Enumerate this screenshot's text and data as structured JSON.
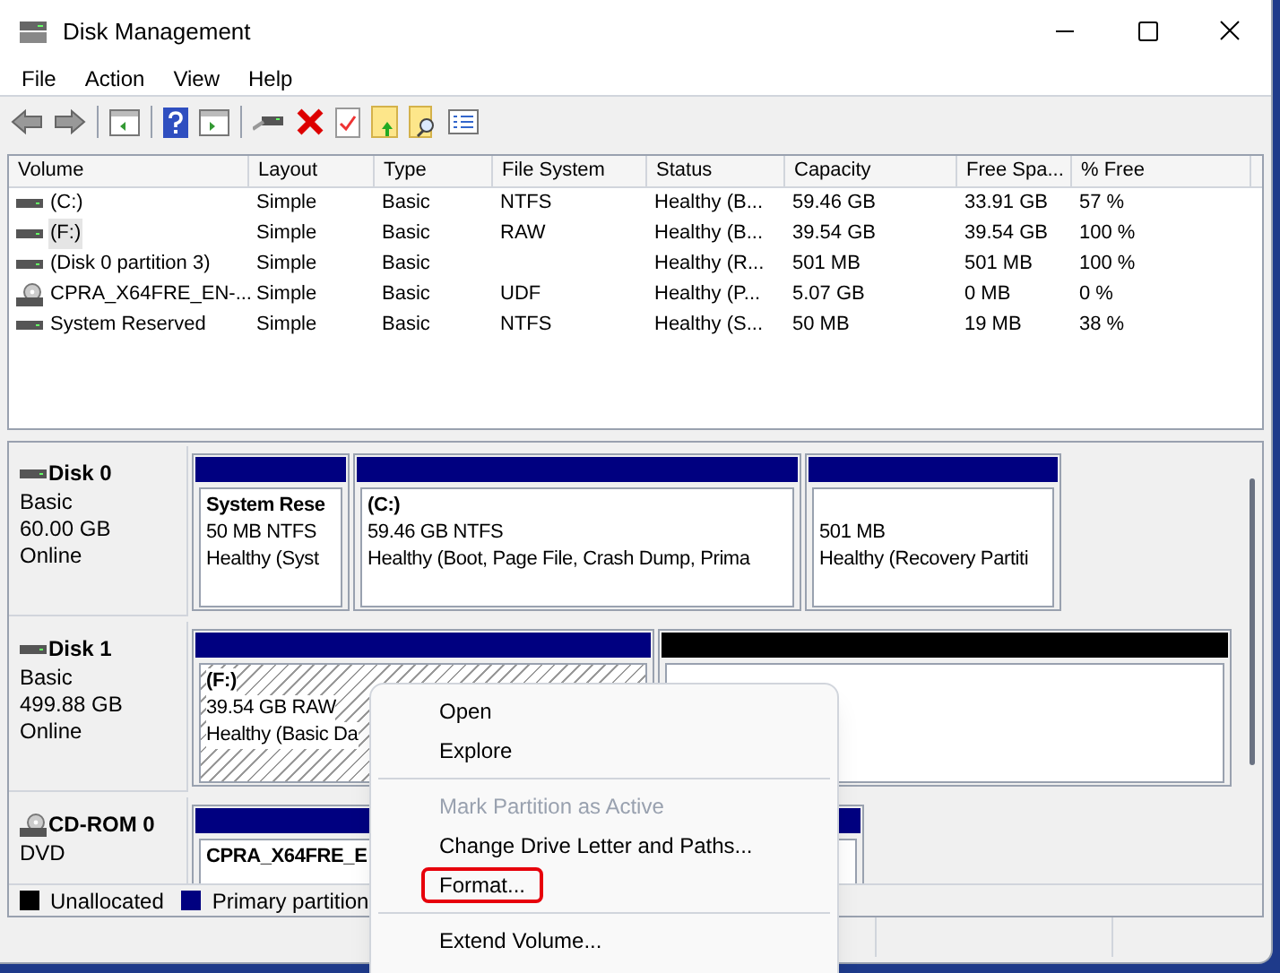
{
  "window": {
    "title": "Disk Management"
  },
  "menu": [
    "File",
    "Action",
    "View",
    "Help"
  ],
  "table": {
    "columns": [
      "Volume",
      "Layout",
      "Type",
      "File System",
      "Status",
      "Capacity",
      "Free Spa...",
      "% Free"
    ],
    "rows": [
      {
        "kind": "disk",
        "selected": false,
        "cells": [
          "(C:)",
          "Simple",
          "Basic",
          "NTFS",
          "Healthy (B...",
          "59.46 GB",
          "33.91 GB",
          "57 %"
        ]
      },
      {
        "kind": "disk",
        "selected": true,
        "cells": [
          "(F:)",
          "Simple",
          "Basic",
          "RAW",
          "Healthy (B...",
          "39.54 GB",
          "39.54 GB",
          "100 %"
        ]
      },
      {
        "kind": "disk",
        "selected": false,
        "cells": [
          "(Disk 0 partition 3)",
          "Simple",
          "Basic",
          "",
          "Healthy (R...",
          "501 MB",
          "501 MB",
          "100 %"
        ]
      },
      {
        "kind": "cd",
        "selected": false,
        "cells": [
          "CPRA_X64FRE_EN-...",
          "Simple",
          "Basic",
          "UDF",
          "Healthy (P...",
          "5.07 GB",
          "0 MB",
          "0 %"
        ]
      },
      {
        "kind": "disk",
        "selected": false,
        "cells": [
          "System Reserved",
          "Simple",
          "Basic",
          "NTFS",
          "Healthy (S...",
          "50 MB",
          "19 MB",
          "38 %"
        ]
      }
    ]
  },
  "disks": [
    {
      "kind": "disk",
      "name": "Disk 0",
      "lines": [
        "Basic",
        "60.00 GB",
        "Online"
      ],
      "partitions": [
        {
          "kind": "primary",
          "selected": false,
          "name": "System Rese",
          "size": "50 MB NTFS",
          "status": "Healthy (Syst"
        },
        {
          "kind": "primary",
          "selected": false,
          "name": "(C:)",
          "size": "59.46 GB NTFS",
          "status": "Healthy (Boot, Page File, Crash Dump, Prima"
        },
        {
          "kind": "primary",
          "selected": false,
          "size": "501 MB",
          "status": "Healthy (Recovery Partiti"
        }
      ]
    },
    {
      "kind": "disk",
      "name": "Disk 1",
      "lines": [
        "Basic",
        "499.88 GB",
        "Online"
      ],
      "partitions": [
        {
          "kind": "primary",
          "selected": true,
          "name": "(F:)",
          "size": "39.54 GB RAW",
          "status": "Healthy (Basic Da"
        },
        {
          "kind": "unallocated",
          "selected": false
        }
      ]
    },
    {
      "kind": "cd",
      "name": "CD-ROM 0",
      "lines": [
        "DVD"
      ],
      "partitions": [
        {
          "kind": "primary",
          "selected": false,
          "name": "CPRA_X64FRE_E"
        }
      ]
    }
  ],
  "legend": [
    {
      "label": "Unallocated",
      "color": "#000000"
    },
    {
      "label": "Primary partition",
      "color": "#000080"
    }
  ],
  "context_menu": [
    {
      "kind": "item",
      "label": "Open",
      "disabled": false,
      "highlighted": false
    },
    {
      "kind": "item",
      "label": "Explore",
      "disabled": false,
      "highlighted": false
    },
    {
      "kind": "separator"
    },
    {
      "kind": "item",
      "label": "Mark Partition as Active",
      "disabled": true,
      "highlighted": false
    },
    {
      "kind": "item",
      "label": "Change Drive Letter and Paths...",
      "disabled": false,
      "highlighted": false
    },
    {
      "kind": "item",
      "label": "Format...",
      "disabled": false,
      "highlighted": true
    },
    {
      "kind": "separator"
    },
    {
      "kind": "item",
      "label": "Extend Volume...",
      "disabled": false,
      "highlighted": false
    }
  ]
}
